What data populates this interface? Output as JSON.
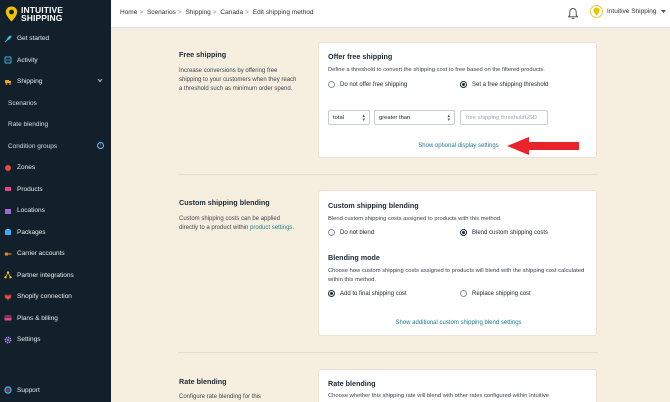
{
  "brand": {
    "line1": "INTUITIVE",
    "line2": "SHIPPING"
  },
  "sidebar": {
    "items": [
      {
        "label": "Get started",
        "icon": "rocket-icon"
      },
      {
        "label": "Activity",
        "icon": "activity-icon"
      },
      {
        "label": "Shipping",
        "icon": "truck-icon"
      },
      {
        "label": "Scenarios"
      },
      {
        "label": "Rate blending"
      },
      {
        "label": "Condition groups"
      },
      {
        "label": "Zones",
        "icon": "globe-icon"
      },
      {
        "label": "Products",
        "icon": "tag-icon"
      },
      {
        "label": "Locations",
        "icon": "building-icon"
      },
      {
        "label": "Packages",
        "icon": "box-icon"
      },
      {
        "label": "Carrier accounts",
        "icon": "key-icon"
      },
      {
        "label": "Partner integrations",
        "icon": "network-icon"
      },
      {
        "label": "Shopify connection",
        "icon": "plug-icon"
      },
      {
        "label": "Plans & billing",
        "icon": "card-icon"
      },
      {
        "label": "Settings",
        "icon": "gear-icon"
      }
    ],
    "support": "Support"
  },
  "header": {
    "breadcrumb": [
      "Home",
      "Scenarios",
      "Shipping",
      "Canada",
      "Edit shipping method"
    ],
    "user": "Intuitive Shipping"
  },
  "free": {
    "title": "Free shipping",
    "desc": "Increase conversions by offering free shipping to your customers when they reach a threshold such as minimum order spend.",
    "card_title": "Offer free shipping",
    "card_sub": "Define a threshold to convert the shipping cost to free based on the filtered products.",
    "opt1": "Do not offer free shipping",
    "opt2": "Set a free shipping threshold",
    "sel1": "total",
    "sel2": "greater than",
    "input_placeholder": "free shipping threshold",
    "input_unit": "USD",
    "link": "Show optional display settings"
  },
  "custom": {
    "title": "Custom shipping blending",
    "desc_pre": "Custom shipping costs can be applied directly to a product within ",
    "desc_link": "product settings",
    "desc_post": ".",
    "card_title": "Custom shipping blending",
    "card_sub": "Blend custom shipping costs assigned to products with this method.",
    "opt1": "Do not blend",
    "opt2": "Blend custom shipping costs",
    "mode_title": "Blending mode",
    "mode_sub": "Choose how custom shipping costs assigned to products will blend with the shipping cost calculated within this method.",
    "mode_opt1": "Add to final shipping cost",
    "mode_opt2": "Replace shipping cost",
    "link": "Show additional custom shipping blend settings"
  },
  "rate": {
    "title": "Rate blending",
    "desc": "Configure rate blending for this",
    "card_title": "Rate blending",
    "card_sub": "Choose whether this shipping rate will blend with other rates configured within Intuitive"
  },
  "colors": {
    "sidebar": "#11202b",
    "background": "#f6efdf",
    "accent_link": "#1e7a8c",
    "arrow": "#e8232a",
    "brand_yellow": "#f2c200"
  }
}
